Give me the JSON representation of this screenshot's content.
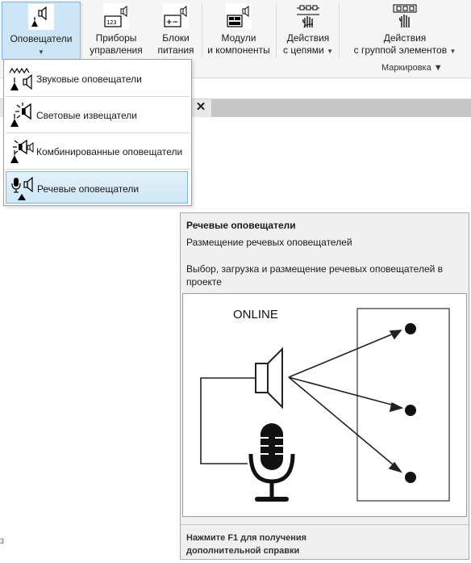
{
  "ribbon": {
    "buttons": [
      {
        "label": "Оповещатели",
        "has_dropdown": true,
        "icon": "horn-speaker-icon"
      },
      {
        "label": "Приборы\nуправления",
        "icon": "control-panel-icon"
      },
      {
        "label": "Блоки\nпитания",
        "icon": "power-supply-icon"
      },
      {
        "label": "Модули\nи компоненты",
        "icon": "modules-icon"
      },
      {
        "label": "Действия\nс цепями",
        "has_dropdown": true,
        "icon": "circuit-hand-icon"
      },
      {
        "label": "Действия\nс группой элементов",
        "has_dropdown": true,
        "icon": "group-hand-icon"
      }
    ],
    "group_label": "Маркировка"
  },
  "menu": {
    "items": [
      {
        "label": "Звуковые оповещатели",
        "icon": "sound-alarm-icon"
      },
      {
        "label": "Световые извещатели",
        "icon": "light-alarm-icon"
      },
      {
        "label": "Комбинированные оповещатели",
        "icon": "combined-alarm-icon"
      },
      {
        "label": "Речевые оповещатели",
        "icon": "voice-alarm-icon",
        "selected": true
      }
    ]
  },
  "tab": {
    "close_glyph": "✕"
  },
  "tooltip": {
    "title": "Речевые оповещатели",
    "subtitle": "Размещение речевых оповещателей",
    "description": "Выбор, загрузка и размещение речевых оповещателей в проекте",
    "image_label": "ONLINE",
    "footer": "Нажмите F1 для получения\nдополнительной справки"
  },
  "stray_mark": "3"
}
